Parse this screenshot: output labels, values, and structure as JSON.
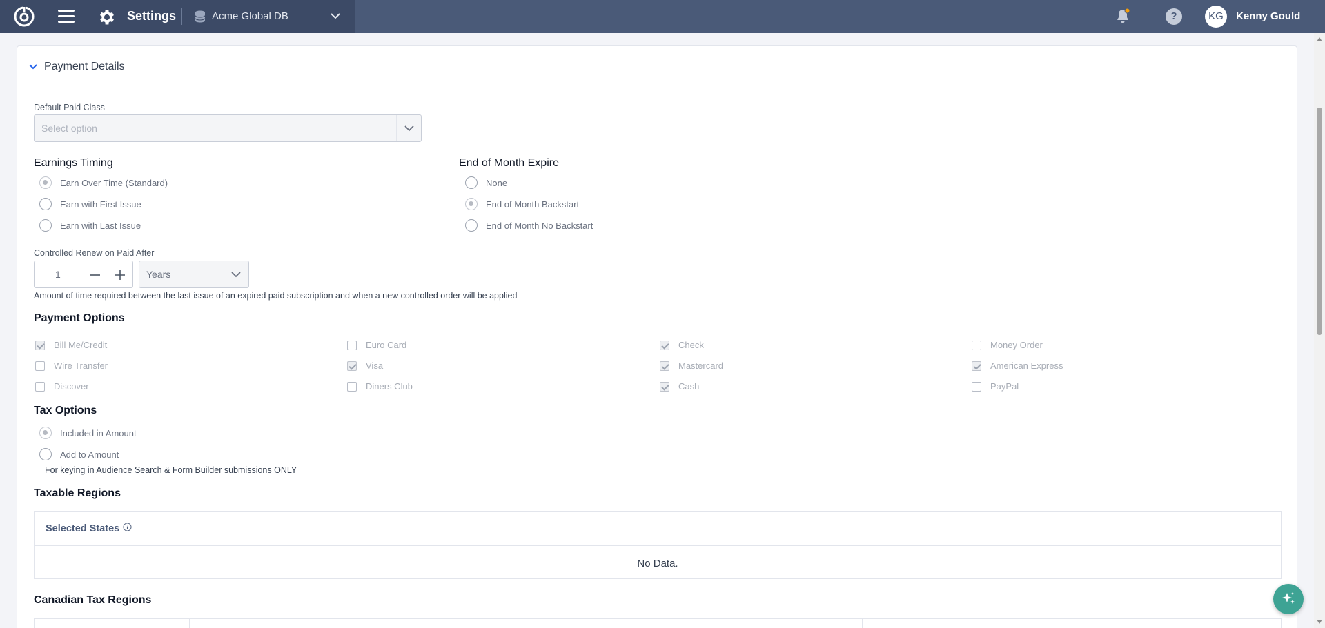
{
  "topbar": {
    "title": "Settings",
    "database": "Acme Global DB",
    "user_initials": "KG",
    "user_name": "Kenny Gould",
    "help_glyph": "?"
  },
  "panel": {
    "title": "Payment Details",
    "default_paid_class": {
      "label": "Default Paid Class",
      "placeholder": "Select option"
    },
    "earnings_timing": {
      "title": "Earnings Timing",
      "options": [
        "Earn Over Time (Standard)",
        "Earn with First Issue",
        "Earn with Last Issue"
      ],
      "selected_index": 0
    },
    "end_of_month_expire": {
      "title": "End of Month Expire",
      "options": [
        "None",
        "End of Month Backstart",
        "End of Month No Backstart"
      ],
      "selected_index": 1
    },
    "controlled_renew": {
      "label": "Controlled Renew on Paid After",
      "value": "1",
      "unit": "Years",
      "help": "Amount of time required between the last issue of an expired paid subscription and when a new controlled order will be applied"
    },
    "payment_options": {
      "title": "Payment Options",
      "items": [
        {
          "label": "Bill Me/Credit",
          "checked": true
        },
        {
          "label": "Euro Card",
          "checked": false
        },
        {
          "label": "Check",
          "checked": true
        },
        {
          "label": "Money Order",
          "checked": false
        },
        {
          "label": "Wire Transfer",
          "checked": false
        },
        {
          "label": "Visa",
          "checked": true
        },
        {
          "label": "Mastercard",
          "checked": true
        },
        {
          "label": "American Express",
          "checked": true
        },
        {
          "label": "Discover",
          "checked": false
        },
        {
          "label": "Diners Club",
          "checked": false
        },
        {
          "label": "Cash",
          "checked": true
        },
        {
          "label": "PayPal",
          "checked": false
        }
      ]
    },
    "tax_options": {
      "title": "Tax Options",
      "options": [
        "Included in Amount",
        "Add to Amount"
      ],
      "selected_index": 0,
      "note": "For keying in Audience Search & Form Builder submissions ONLY"
    },
    "taxable_regions": {
      "title": "Taxable Regions",
      "column": "Selected States",
      "empty": "No Data."
    },
    "canadian_tax_regions": {
      "title": "Canadian Tax Regions"
    }
  },
  "colors": {
    "topbar": "#4a5a78",
    "fab": "#3ea394",
    "accent": "#2563eb"
  }
}
